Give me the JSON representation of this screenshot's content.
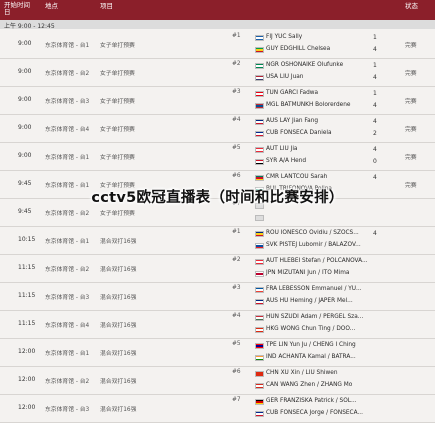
{
  "header": {
    "date_col": "开始时间\n日",
    "venue_col": "地点",
    "event_col": "项目",
    "status_col": "状态"
  },
  "subheader": {
    "label": "上午  9:00 - 12:45"
  },
  "overlay": {
    "text": "cctv5欧冠直播表（时间和比赛安排）"
  },
  "colors": {
    "header": "#8b1f2a",
    "background": "#f4f2f0"
  },
  "rows": [
    {
      "time": "9:00",
      "venue": "东京体育馆 - 台1",
      "event": "女子单打预赛",
      "match": "#1",
      "teams": [
        {
          "name": "FIJ YUC Sally",
          "score": "1",
          "flag": [
            "#1a5fa8",
            "#ffffff",
            "#1a5fa8"
          ]
        },
        {
          "name": "GUY EDGHILL Chelsea",
          "score": "4",
          "flag": [
            "#009e49",
            "#fcd116",
            "#ce1126"
          ]
        }
      ],
      "result": "完赛"
    },
    {
      "time": "9:00",
      "venue": "东京体育馆 - 台2",
      "event": "女子单打预赛",
      "match": "#2",
      "teams": [
        {
          "name": "NGR OSHONAIKE Olufunke",
          "score": "1",
          "flag": [
            "#008751",
            "#ffffff",
            "#008751"
          ]
        },
        {
          "name": "USA LIU Juan",
          "score": "4",
          "flag": [
            "#b22234",
            "#ffffff",
            "#3c3b6e"
          ]
        }
      ],
      "result": "完赛"
    },
    {
      "time": "9:00",
      "venue": "东京体育馆 - 台3",
      "event": "女子单打预赛",
      "match": "#3",
      "teams": [
        {
          "name": "TUN GARCI Fadwa",
          "score": "1",
          "flag": [
            "#e70013",
            "#ffffff",
            "#e70013"
          ]
        },
        {
          "name": "MGL BATMUNKH Bolorerdene",
          "score": "4",
          "flag": [
            "#c4272f",
            "#015197",
            "#c4272f"
          ]
        }
      ],
      "result": "完赛"
    },
    {
      "time": "9:00",
      "venue": "东京体育馆 - 台4",
      "event": "女子单打预赛",
      "match": "#4",
      "teams": [
        {
          "name": "AUS LAY Jian Fang",
          "score": "4",
          "flag": [
            "#00247d",
            "#ffffff",
            "#cf142b"
          ]
        },
        {
          "name": "CUB FONSECA Daniela",
          "score": "2",
          "flag": [
            "#002a8f",
            "#ffffff",
            "#cf142b"
          ]
        }
      ],
      "result": "完赛"
    },
    {
      "time": "9:00",
      "venue": "东京体育馆 - 台1",
      "event": "女子单打预赛",
      "match": "#5",
      "teams": [
        {
          "name": "AUT LIU Jia",
          "score": "4",
          "flag": [
            "#ed2939",
            "#ffffff",
            "#ed2939"
          ]
        },
        {
          "name": "SYR A/A Hend",
          "score": "0",
          "flag": [
            "#ce1126",
            "#ffffff",
            "#000000"
          ]
        }
      ],
      "result": "完赛"
    },
    {
      "time": "9:45",
      "venue": "东京体育馆 - 台1",
      "event": "女子单打预赛",
      "match": "#6",
      "teams": [
        {
          "name": "CMR LANTCOU Sarah",
          "score": "4",
          "flag": [
            "#007a5e",
            "#ce1126",
            "#fcd116"
          ]
        },
        {
          "name": "BUL TRIFONOVA Polina",
          "score": "",
          "flag": [
            "#ffffff",
            "#00966e",
            "#d62612"
          ]
        }
      ],
      "result": "完赛"
    },
    {
      "time": "9:45",
      "venue": "东京体育馆 - 台2",
      "event": "女子单打预赛",
      "match": "#7",
      "teams": [
        {
          "name": "",
          "score": "",
          "flag": [
            "#dddddd",
            "#dddddd",
            "#dddddd"
          ]
        },
        {
          "name": "",
          "score": "",
          "flag": [
            "#dddddd",
            "#dddddd",
            "#dddddd"
          ]
        }
      ],
      "result": ""
    },
    {
      "time": "10:15",
      "venue": "东京体育馆 - 台1",
      "event": "混合双打16强",
      "match": "#1",
      "teams": [
        {
          "name": "ROU IONESCO Ovidiu / SZOCS...",
          "score": "4",
          "flag": [
            "#002b7f",
            "#fcd116",
            "#ce1126"
          ]
        },
        {
          "name": "SVK PISTEJ Lubomir / BALAZOV...",
          "score": "",
          "flag": [
            "#ffffff",
            "#0b4ea2",
            "#ee1c25"
          ]
        }
      ],
      "result": ""
    },
    {
      "time": "11:15",
      "venue": "东京体育馆 - 台2",
      "event": "混合双打16强",
      "match": "#2",
      "teams": [
        {
          "name": "AUT HLEBEI Stefan / POLCANOVA...",
          "score": "",
          "flag": [
            "#ed2939",
            "#ffffff",
            "#ed2939"
          ]
        },
        {
          "name": "JPN MIZUTANI Jun / ITO Mima",
          "score": "",
          "flag": [
            "#ffffff",
            "#bc002d",
            "#ffffff"
          ]
        }
      ],
      "result": ""
    },
    {
      "time": "11:15",
      "venue": "东京体育馆 - 台3",
      "event": "混合双打16强",
      "match": "#3",
      "teams": [
        {
          "name": "FRA LEBESSON Emmanuel / YU...",
          "score": "",
          "flag": [
            "#0055a4",
            "#ffffff",
            "#ef4135"
          ]
        },
        {
          "name": "AUS HU Heming / JAPER Mel...",
          "score": "",
          "flag": [
            "#00247d",
            "#ffffff",
            "#cf142b"
          ]
        }
      ],
      "result": ""
    },
    {
      "time": "11:15",
      "venue": "东京体育馆 - 台4",
      "event": "混合双打16强",
      "match": "#4",
      "teams": [
        {
          "name": "HUN SZUDI Adam / PERGEL Sza...",
          "score": "",
          "flag": [
            "#ce2939",
            "#ffffff",
            "#477050"
          ]
        },
        {
          "name": "HKG WONG Chun Ting / DOO...",
          "score": "",
          "flag": [
            "#de2910",
            "#ffffff",
            "#de2910"
          ]
        }
      ],
      "result": ""
    },
    {
      "time": "12:00",
      "venue": "东京体育馆 - 台1",
      "event": "混合双打16强",
      "match": "#5",
      "teams": [
        {
          "name": "TPE LIN Yun Ju / CHENG I Ching",
          "score": "",
          "flag": [
            "#fe0000",
            "#000095",
            "#fe0000"
          ]
        },
        {
          "name": "IND ACHANTA Kamal / BATRA...",
          "score": "",
          "flag": [
            "#ff9933",
            "#ffffff",
            "#138808"
          ]
        }
      ],
      "result": ""
    },
    {
      "time": "12:00",
      "venue": "东京体育馆 - 台2",
      "event": "混合双打16强",
      "match": "#6",
      "teams": [
        {
          "name": "CHN XU Xin / LIU Shiwen",
          "score": "",
          "flag": [
            "#de2910",
            "#de2910",
            "#de2910"
          ]
        },
        {
          "name": "CAN WANG Zhen / ZHANG Mo",
          "score": "",
          "flag": [
            "#d52b1e",
            "#ffffff",
            "#d52b1e"
          ]
        }
      ],
      "result": ""
    },
    {
      "time": "12:00",
      "venue": "东京体育馆 - 台3",
      "event": "混合双打16强",
      "match": "#7",
      "teams": [
        {
          "name": "GER FRANZISKA Patrick / SOL...",
          "score": "",
          "flag": [
            "#000000",
            "#dd0000",
            "#ffce00"
          ]
        },
        {
          "name": "CUB FONSECA Jorge / FONSECA...",
          "score": "",
          "flag": [
            "#002a8f",
            "#ffffff",
            "#cf142b"
          ]
        }
      ],
      "result": ""
    }
  ]
}
